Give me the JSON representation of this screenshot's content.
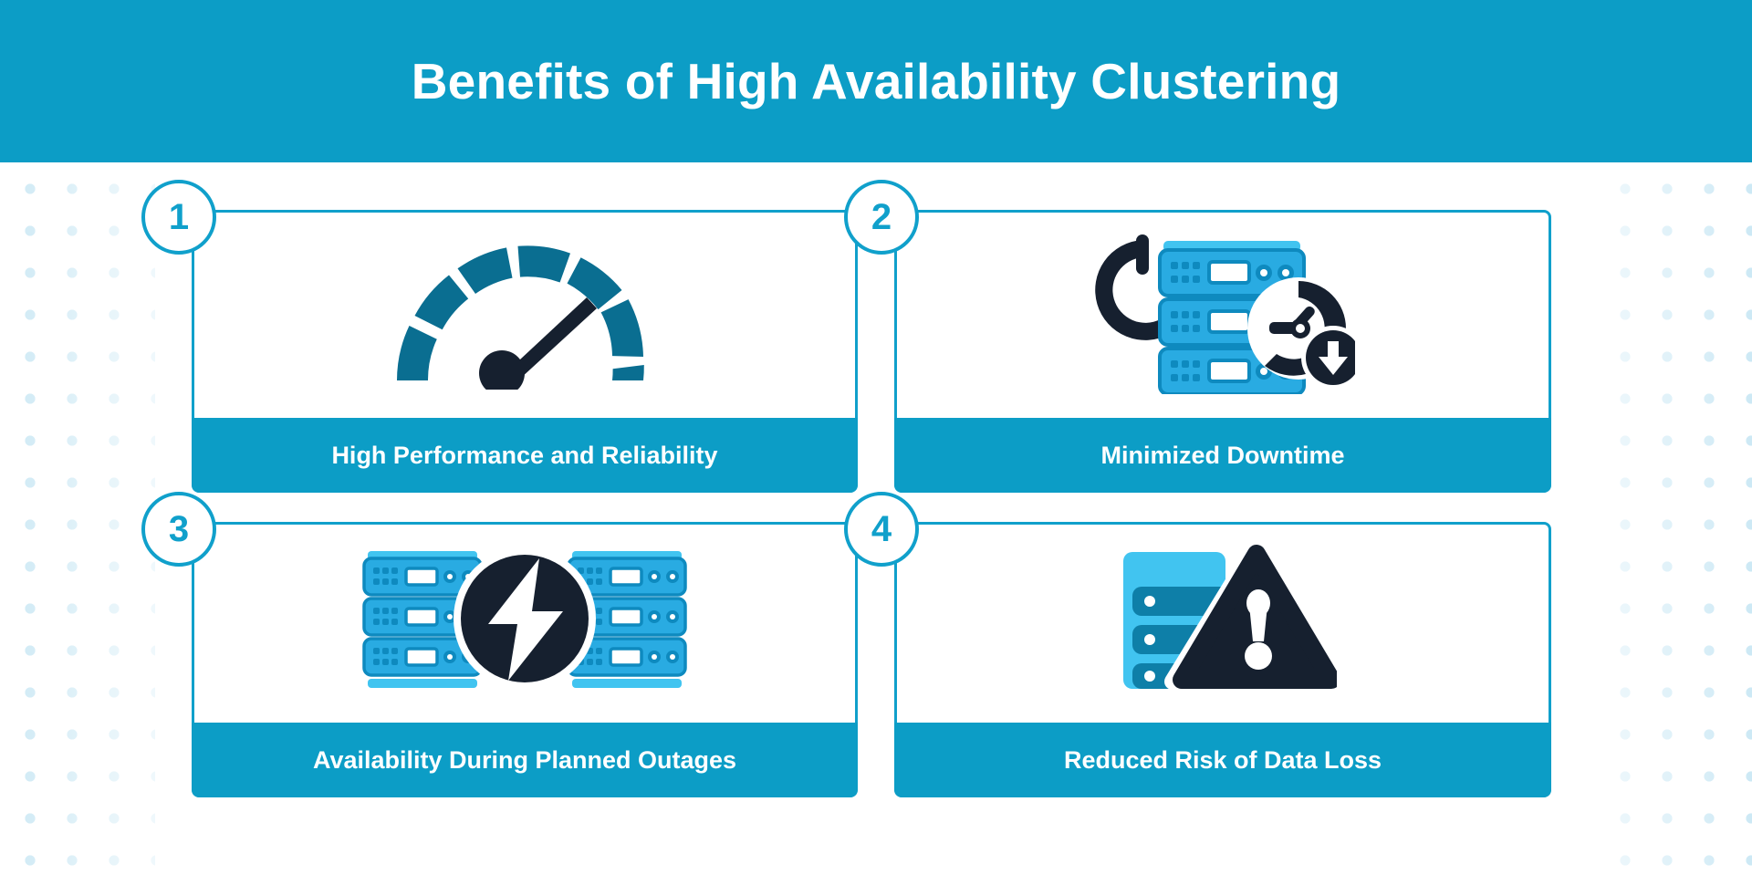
{
  "header": {
    "title": "Benefits of High Availability Clustering",
    "background_color": "#0C9DC6",
    "text_color": "#FFFFFF"
  },
  "theme": {
    "cyan": "#0C9DC6",
    "cyan_border": "#10A0CB",
    "light_blue": "#29ABE2",
    "sky_blue": "#41C4F0",
    "deep_teal": "#0A6E91",
    "navy": "#16202F",
    "dot_blue": "#CDE9F5",
    "white": "#FFFFFF"
  },
  "cards": [
    {
      "number": "1",
      "label": "High Performance and Reliability",
      "icon": "speedometer-gauge-icon"
    },
    {
      "number": "2",
      "label": "Minimized Downtime",
      "icon": "server-power-clock-icon"
    },
    {
      "number": "3",
      "label": "Availability During Planned Outages",
      "icon": "servers-lightning-bolt-icon"
    },
    {
      "number": "4",
      "label": "Reduced Risk of Data Loss",
      "icon": "database-warning-icon"
    }
  ]
}
